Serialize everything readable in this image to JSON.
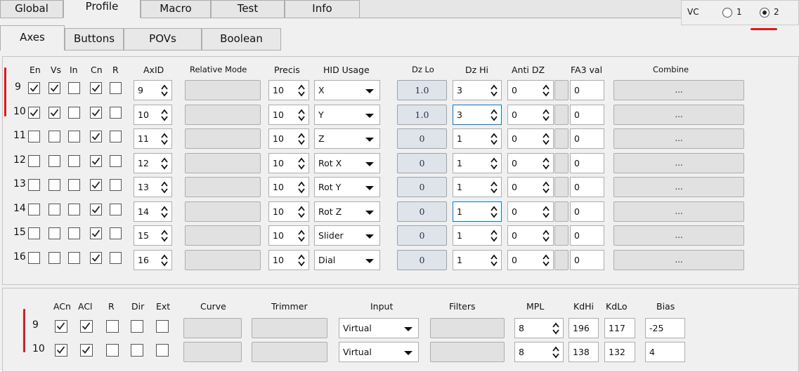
{
  "main_tabs": [
    "Global",
    "Profile",
    "Macro",
    "Test",
    "Info"
  ],
  "active_main_tab": "Profile",
  "vc": {
    "label": "VC",
    "options": [
      "1",
      "2"
    ],
    "selected": "2"
  },
  "sub_tabs": [
    "Axes",
    "Buttons",
    "POVs",
    "Boolean"
  ],
  "active_sub_tab": "Axes",
  "axes_table": {
    "headers": {
      "en": "En",
      "vs": "Vs",
      "in": "In",
      "cn": "Cn",
      "r": "R",
      "axid": "AxID",
      "relative_mode": "Relative Mode",
      "precis": "Precis",
      "hid_usage": "HID Usage",
      "dz_lo": "Dz Lo",
      "dz_hi": "Dz Hi",
      "anti_dz": "Anti DZ",
      "fa3_val": "FA3 val",
      "combine": "Combine"
    },
    "combine_label": "...",
    "rows": [
      {
        "num": "9",
        "en": true,
        "vs": true,
        "in": false,
        "cn": true,
        "r": false,
        "axid": "9",
        "precis": "10",
        "hid": "X",
        "dz_lo": "1.0",
        "dz_hi": "3",
        "anti_dz": "0",
        "fa3": "0",
        "dz_hi_focus": false
      },
      {
        "num": "10",
        "en": true,
        "vs": true,
        "in": false,
        "cn": true,
        "r": false,
        "axid": "10",
        "precis": "10",
        "hid": "Y",
        "dz_lo": "1.0",
        "dz_hi": "3",
        "anti_dz": "0",
        "fa3": "0",
        "dz_hi_focus": true
      },
      {
        "num": "11",
        "en": false,
        "vs": false,
        "in": false,
        "cn": true,
        "r": false,
        "axid": "11",
        "precis": "10",
        "hid": "Z",
        "dz_lo": "0",
        "dz_hi": "1",
        "anti_dz": "0",
        "fa3": "0",
        "dz_hi_focus": false
      },
      {
        "num": "12",
        "en": false,
        "vs": false,
        "in": false,
        "cn": true,
        "r": false,
        "axid": "12",
        "precis": "10",
        "hid": "Rot X",
        "dz_lo": "0",
        "dz_hi": "1",
        "anti_dz": "0",
        "fa3": "0",
        "dz_hi_focus": false
      },
      {
        "num": "13",
        "en": false,
        "vs": false,
        "in": false,
        "cn": true,
        "r": false,
        "axid": "13",
        "precis": "10",
        "hid": "Rot Y",
        "dz_lo": "0",
        "dz_hi": "1",
        "anti_dz": "0",
        "fa3": "0",
        "dz_hi_focus": false
      },
      {
        "num": "14",
        "en": false,
        "vs": false,
        "in": false,
        "cn": true,
        "r": false,
        "axid": "14",
        "precis": "10",
        "hid": "Rot Z",
        "dz_lo": "0",
        "dz_hi": "1",
        "anti_dz": "0",
        "fa3": "0",
        "dz_hi_focus": true
      },
      {
        "num": "15",
        "en": false,
        "vs": false,
        "in": false,
        "cn": true,
        "r": false,
        "axid": "15",
        "precis": "10",
        "hid": "Slider",
        "dz_lo": "0",
        "dz_hi": "1",
        "anti_dz": "0",
        "fa3": "0",
        "dz_hi_focus": false
      },
      {
        "num": "16",
        "en": false,
        "vs": false,
        "in": false,
        "cn": true,
        "r": false,
        "axid": "16",
        "precis": "10",
        "hid": "Dial",
        "dz_lo": "0",
        "dz_hi": "1",
        "anti_dz": "0",
        "fa3": "0",
        "dz_hi_focus": false
      }
    ]
  },
  "curve_table": {
    "headers": {
      "acn": "ACn",
      "acl": "ACl",
      "r": "R",
      "dir": "Dir",
      "ext": "Ext",
      "curve": "Curve",
      "trimmer": "Trimmer",
      "input": "Input",
      "filters": "Filters",
      "mpl": "MPL",
      "kdhi": "KdHi",
      "kdlo": "KdLo",
      "bias": "Bias"
    },
    "rows": [
      {
        "num": "9",
        "acn": true,
        "acl": true,
        "r": false,
        "dir": false,
        "ext": false,
        "input": "Virtual",
        "mpl": "8",
        "kdhi": "196",
        "kdlo": "117",
        "bias": "-25"
      },
      {
        "num": "10",
        "acn": true,
        "acl": true,
        "r": false,
        "dir": false,
        "ext": false,
        "input": "Virtual",
        "mpl": "8",
        "kdhi": "138",
        "kdlo": "132",
        "bias": "4"
      }
    ]
  },
  "colors": {
    "accent_red": "#e0181d",
    "focus_blue": "#0078d7"
  }
}
